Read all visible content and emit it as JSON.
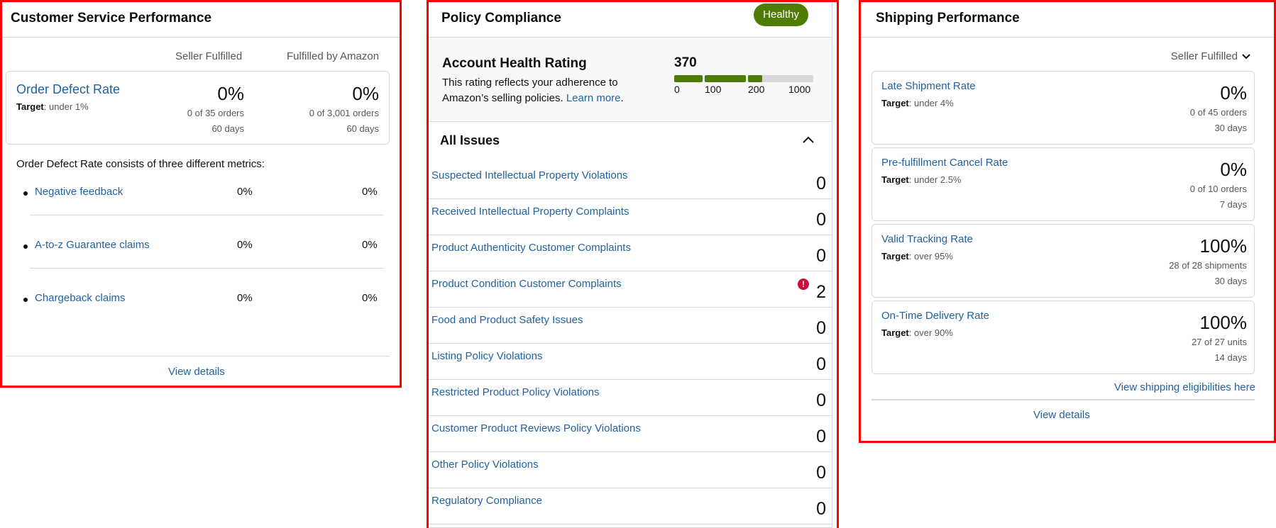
{
  "customer_service": {
    "title": "Customer Service Performance",
    "col_seller": "Seller Fulfilled",
    "col_fba": "Fulfilled by Amazon",
    "odr": {
      "title": "Order Defect Rate",
      "target_label": "Target",
      "target_value": ": under 1%",
      "seller_pct": "0%",
      "seller_orders": "0 of 35 orders",
      "seller_days": "60 days",
      "fba_pct": "0%",
      "fba_orders": "0 of 3,001 orders",
      "fba_days": "60 days"
    },
    "description": "Order Defect Rate consists of three different metrics:",
    "metrics": [
      {
        "name": "Negative feedback",
        "seller": "0%",
        "fba": "0%"
      },
      {
        "name": "A-to-z Guarantee claims",
        "seller": "0%",
        "fba": "0%"
      },
      {
        "name": "Chargeback claims",
        "seller": "0%",
        "fba": "0%"
      }
    ],
    "view_details": "View details"
  },
  "policy_compliance": {
    "title": "Policy Compliance",
    "status_badge": "Healthy",
    "rating_title": "Account Health Rating",
    "rating_desc": "This rating reflects your adherence to Amazon’s selling policies.",
    "learn_more": "Learn more",
    "rating_score": "370",
    "rating_score_value": 370,
    "scale_ticks": [
      "0",
      "100",
      "200",
      "1000"
    ],
    "colors": {
      "good": "#507c06",
      "empty": "#d5d9d9",
      "badge": "#507c06",
      "alert": "#cc0c39"
    },
    "issues_title": "All Issues",
    "issues": [
      {
        "name": "Suspected Intellectual Property Violations",
        "count": "0"
      },
      {
        "name": "Received Intellectual Property Complaints",
        "count": "0"
      },
      {
        "name": "Product Authenticity Customer Complaints",
        "count": "0"
      },
      {
        "name": "Product Condition Customer Complaints",
        "count": "2",
        "alert_icon": "exclamation-circle-icon"
      },
      {
        "name": "Food and Product Safety Issues",
        "count": "0"
      },
      {
        "name": "Listing Policy Violations",
        "count": "0"
      },
      {
        "name": "Restricted Product Policy Violations",
        "count": "0"
      },
      {
        "name": "Customer Product Reviews Policy Violations",
        "count": "0"
      },
      {
        "name": "Other Policy Violations",
        "count": "0"
      },
      {
        "name": "Regulatory Compliance",
        "count": "0"
      }
    ]
  },
  "shipping": {
    "title": "Shipping Performance",
    "filter": "Seller Fulfilled",
    "target_label": "Target",
    "cards": [
      {
        "name": "Late Shipment Rate",
        "target": ": under 4%",
        "pct": "0%",
        "detail": "0 of 45 orders",
        "days": "30 days"
      },
      {
        "name": "Pre-fulfillment Cancel Rate",
        "target": ": under 2.5%",
        "pct": "0%",
        "detail": "0 of 10 orders",
        "days": "7 days"
      },
      {
        "name": "Valid Tracking Rate",
        "target": ": over 95%",
        "pct": "100%",
        "detail": "28 of 28 shipments",
        "days": "30 days"
      },
      {
        "name": "On-Time Delivery Rate",
        "target": ": over 90%",
        "pct": "100%",
        "detail": "27 of 27 units",
        "days": "14 days"
      }
    ],
    "eligibilities_link": "View shipping eligibilities here",
    "view_details": "View details"
  }
}
